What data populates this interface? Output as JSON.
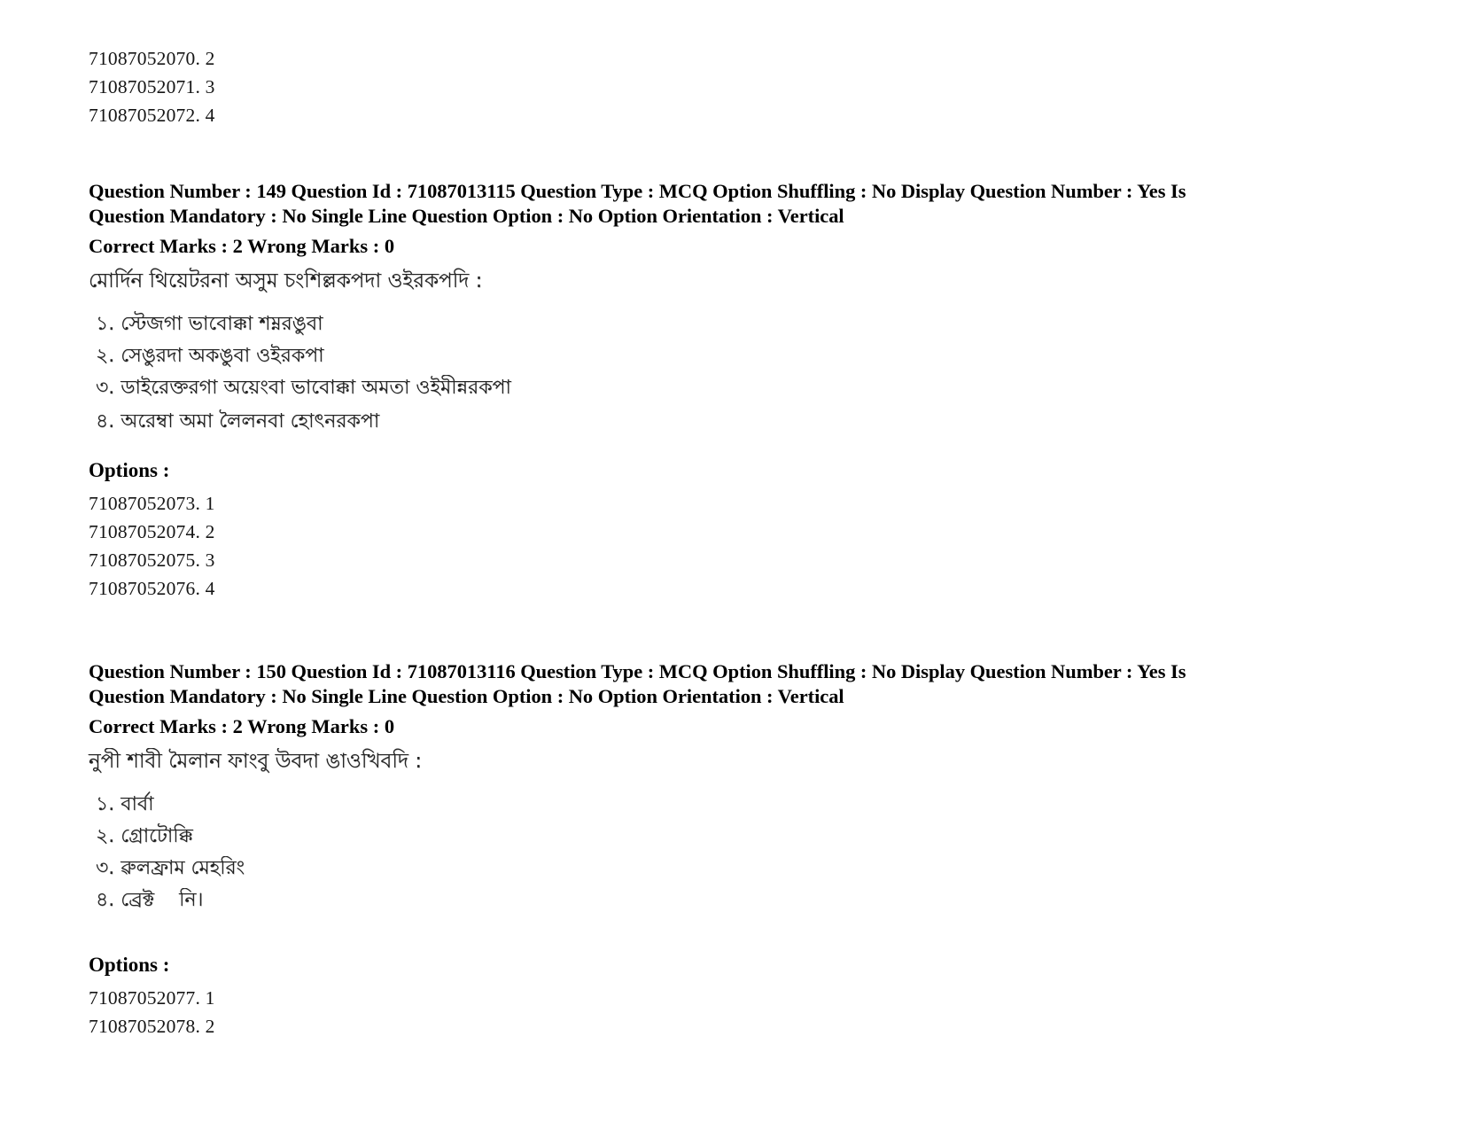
{
  "document": {
    "type": "exam-question-paper",
    "script_note": "Bengali / Meitei Mayek scanned text"
  },
  "top_option_ids": [
    "71087052070. 2",
    "71087052071. 3",
    "71087052072. 4"
  ],
  "questions": [
    {
      "meta_line1": "Question Number : 149 Question Id : 71087013115 Question Type : MCQ Option Shuffling : No Display Question Number : Yes Is",
      "meta_line2": "Question Mandatory : No Single Line Question Option : No Option Orientation : Vertical",
      "marks_line": "Correct Marks : 2 Wrong Marks : 0",
      "question_text": "মোর্দিন থিয়েটরনা অসুম চংশিল্লকপদা ওইরকপদি :",
      "choices": [
        "১. স্টেজগা ভাবোক্কা শম্নরঙুবা",
        "২. সেঙুরদা অকঙুবা ওইরকপা",
        "৩. ডাইরেক্তরগা অয়েংবা ভাবোক্কা অমতা ওইমীন্নরকপা",
        "৪. অরেম্বা অমা লৈলনবা হোৎনরকপা"
      ],
      "options_label": "Options :",
      "option_ids": [
        "71087052073. 1",
        "71087052074. 2",
        "71087052075. 3",
        "71087052076. 4"
      ]
    },
    {
      "meta_line1": "Question Number : 150 Question Id : 71087013116 Question Type : MCQ Option Shuffling : No Display Question Number : Yes Is",
      "meta_line2": "Question Mandatory : No Single Line Question Option : No Option Orientation : Vertical",
      "marks_line": "Correct Marks : 2 Wrong Marks : 0",
      "question_text": "নুপী শাবী মৈলান ফাংবু উবদা ঙাওখিবদি :",
      "choices": [
        "১. বার্বা",
        "২. গ্রোটোক্কি",
        "৩. ৱুলফ্রাম মেহরিং",
        "৪. ব্রেক্ট    নি।"
      ],
      "options_label": "Options :",
      "option_ids": [
        "71087052077. 1",
        "71087052078. 2"
      ]
    }
  ]
}
